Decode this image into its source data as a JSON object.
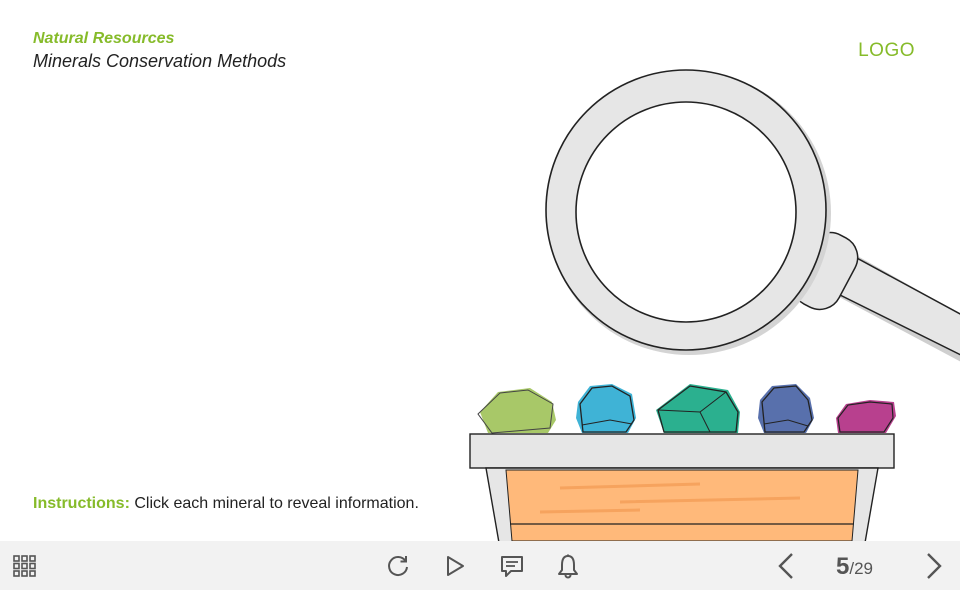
{
  "header": {
    "course_title": "Natural Resources",
    "slide_title": "Minerals Conservation Methods",
    "logo": "LOGO"
  },
  "instructions": {
    "label": "Instructions:",
    "text": " Click each mineral to reveal information."
  },
  "minerals": [
    {
      "color": "#a8c868",
      "name": "green mineral"
    },
    {
      "color": "#3fb3d6",
      "name": "blue mineral"
    },
    {
      "color": "#2bb08f",
      "name": "teal mineral"
    },
    {
      "color": "#5870ac",
      "name": "indigo mineral"
    },
    {
      "color": "#b8408e",
      "name": "magenta mineral"
    }
  ],
  "colors": {
    "accent": "#86bb2a",
    "toolbar_bg": "#f2f2f2",
    "icon": "#555555",
    "crate": "#ffb97a"
  },
  "toolbar": {
    "menu_icon": "grid-menu-icon",
    "replay_icon": "replay-icon",
    "play_icon": "play-icon",
    "notes_icon": "notes-icon",
    "bell_icon": "bell-icon",
    "prev_icon": "chevron-left-icon",
    "next_icon": "chevron-right-icon"
  },
  "pager": {
    "current": "5",
    "total": "/29"
  }
}
